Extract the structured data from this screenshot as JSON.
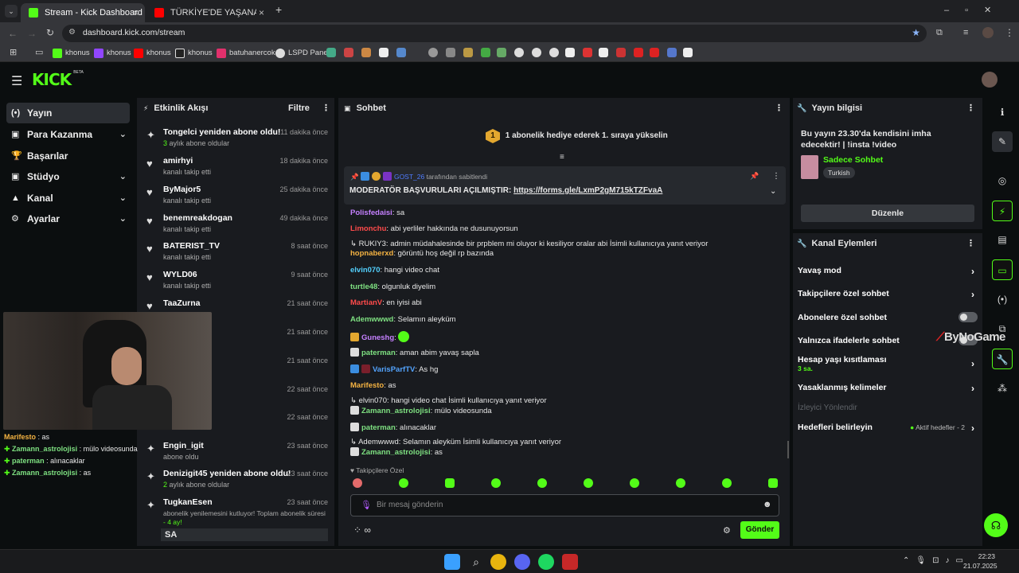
{
  "browser": {
    "tabs": [
      {
        "title": "Stream - Kick Dashboard",
        "active": true
      },
      {
        "title": "TÜRKİYE'DE YAŞANAN MOTOR",
        "active": false
      }
    ],
    "new_tab": "+",
    "url": "dashboard.kick.com/stream",
    "bookmarks": [
      {
        "label": "khonus",
        "color": "#53fc18"
      },
      {
        "label": "khonus",
        "color": "#9146ff"
      },
      {
        "label": "khonus",
        "color": "#ff0000"
      },
      {
        "label": "khonus",
        "color": "#ffffff"
      },
      {
        "label": "batuhanercok",
        "color": "#e1306c"
      },
      {
        "label": "LSPD Panel",
        "color": "#dddddd"
      }
    ]
  },
  "app": {
    "logo": "KICK",
    "logo_sup": "BETA"
  },
  "sidebar": {
    "items": [
      {
        "label": "Yayın",
        "icon": "(•)",
        "chevron": false,
        "active": true
      },
      {
        "label": "Para Kazanma",
        "icon": "▣",
        "chevron": true
      },
      {
        "label": "Başarılar",
        "icon": "🏆",
        "chevron": false
      },
      {
        "label": "Stüdyo",
        "icon": "▣",
        "chevron": true
      },
      {
        "label": "Kanal",
        "icon": "▲",
        "chevron": true
      },
      {
        "label": "Ayarlar",
        "icon": "⚙",
        "chevron": true
      }
    ]
  },
  "activity": {
    "title": "Etkinlik Akışı",
    "filter": "Filtre",
    "items": [
      {
        "name": "Tongelci yeniden abone oldu!",
        "sub_highlight": "3",
        "sub": " aylık abone oldular",
        "time": "11 dakika önce",
        "icon": "✦"
      },
      {
        "name": "amirhyi",
        "sub": "kanalı takip etti",
        "time": "18 dakika önce",
        "icon": "♥"
      },
      {
        "name": "ByMajor5",
        "sub": "kanalı takip etti",
        "time": "25 dakika önce",
        "icon": "♥"
      },
      {
        "name": "benemreakdogan",
        "sub": "kanalı takip etti",
        "time": "49 dakika önce",
        "icon": "♥"
      },
      {
        "name": "BATERIST_TV",
        "sub": "kanalı takip etti",
        "time": "8 saat önce",
        "icon": "♥"
      },
      {
        "name": "WYLD06",
        "sub": "kanalı takip etti",
        "time": "9 saat önce",
        "icon": "♥"
      },
      {
        "name": "TaaZurna",
        "sub": "kanalı takip etti",
        "time": "21 saat önce",
        "icon": "♥"
      },
      {
        "name": "",
        "sub": "",
        "time": "21 saat önce",
        "icon": ""
      },
      {
        "name": "",
        "sub": "",
        "time": "21 saat önce",
        "icon": ""
      },
      {
        "name": "",
        "sub": "",
        "time": "22 saat önce",
        "icon": ""
      },
      {
        "name": "",
        "sub": "",
        "time": "22 saat önce",
        "icon": ""
      },
      {
        "name": "Engin_igit",
        "sub": "abone oldu",
        "time": "23 saat önce",
        "icon": "✦"
      },
      {
        "name": "Denizigit45 yeniden abone oldu!",
        "sub_highlight": "2",
        "sub": " aylık abone oldular",
        "time": "23 saat önce",
        "icon": "✦"
      },
      {
        "name": "TugkanEsen",
        "sub": "abonelik yenilemesini kutluyor! Toplam abonelik süresi",
        "sub2": "- 4 ay!",
        "time": "23 saat önce",
        "icon": "✦"
      }
    ],
    "footer": "SA"
  },
  "overlay_chat": [
    {
      "user": "Marifesto",
      "msg": " : as",
      "color": "#f5b342",
      "badge": false
    },
    {
      "user": "Zamann_astrolojisi",
      "msg": " : mülo videosunda",
      "color": "#7ee081",
      "badge": true
    },
    {
      "user": "paterman",
      "msg": " : alınacaklar",
      "color": "#7ee081",
      "badge": true
    },
    {
      "user": "Zamann_astrolojisi",
      "msg": " : as",
      "color": "#7ee081",
      "badge": true
    }
  ],
  "chat": {
    "title": "Sohbet",
    "gift_banner": "1 abonelik hediye ederek 1. sıraya yükselin",
    "gift_rank": "1",
    "pinned": {
      "by": "GOST_26",
      "by_suffix": " tarafından sabitlendi",
      "text": "MODERATÖR BAŞVURULARI AÇILMIŞTIR: ",
      "link": "https://forms.gle/LxmP2gM715kTZFvaA"
    },
    "messages": [
      {
        "user": "Polisfedaisi",
        "msg": ": sa",
        "color": "#c580ff"
      },
      {
        "user": "Limonchu",
        "msg": ": abi yerliler hakkında ne dusunuyorsun",
        "color": "#ff4b4b"
      },
      {
        "reply": "↳ RUKIY3: admin müdahalesinde bir prpblem mi oluyor ki kesiliyor oralar abi İsimli kullanıcıya yanıt veriyor"
      },
      {
        "user": "hopnaberxd",
        "msg": ": görüntü hoş değil rp bazında",
        "color": "#f5b342"
      },
      {
        "user": "elvin070",
        "msg": ": hangi video chat",
        "color": "#53d1ff"
      },
      {
        "user": "turtle48",
        "msg": ": olgunluk diyelim",
        "color": "#7ee081"
      },
      {
        "user": "MartianV",
        "msg": ": en iyisi abi",
        "color": "#ff4b4b"
      },
      {
        "user": "Ademwwwd",
        "msg": ": Selamın aleyküm",
        "color": "#7ee081"
      },
      {
        "user": "Guneshg",
        "msg": ": ",
        "color": "#c580ff",
        "emote": true
      },
      {
        "user": "paterman",
        "msg": ": aman abim yavaş sapla",
        "color": "#7ee081"
      },
      {
        "user": "VarisParfTV",
        "msg": ": As hg",
        "color": "#53a4ff"
      },
      {
        "user": "Marifesto",
        "msg": ": as",
        "color": "#f5b342"
      },
      {
        "reply": "↳ elvin070: hangi video chat İsimli kullanıcıya yanıt veriyor"
      },
      {
        "user": "Zamann_astrolojisi",
        "msg": ": mülo videosunda",
        "color": "#7ee081"
      },
      {
        "user": "paterman",
        "msg": ": alınacaklar",
        "color": "#7ee081"
      },
      {
        "reply": "↳ Ademwwwd: Selamın aleyküm İsimli kullanıcıya yanıt veriyor"
      },
      {
        "user": "Zamann_astrolojisi",
        "msg": ": as",
        "color": "#7ee081"
      }
    ],
    "followers_only": "Takipçilere Özel",
    "input_placeholder": "Bir mesaj gönderin",
    "send": "Gönder",
    "points": "∞"
  },
  "stream_info": {
    "title": "Yayın bilgisi",
    "stream_title": "Bu yayın 23.30'da kendisini imha edecektir! | !insta !video",
    "category": "Sadece Sohbet",
    "language": "Turkish",
    "edit": "Düzenle"
  },
  "channel_actions": {
    "title": "Kanal Eylemleri",
    "items": [
      {
        "label": "Yavaş mod",
        "chevron": true
      },
      {
        "label": "Takipçilere özel sohbet",
        "chevron": true
      },
      {
        "label": "Abonelere özel sohbet",
        "toggle": true
      },
      {
        "label": "Yalnızca ifadelerle sohbet",
        "toggle": true
      },
      {
        "label": "Hesap yaşı kısıtlaması",
        "sub": "3 sa.",
        "chevron": true
      },
      {
        "label": "Yasaklanmış kelimeler",
        "chevron": true
      },
      {
        "label": "İzleyici Yönlendir",
        "disabled": true
      },
      {
        "label": "Hedefleri belirleyin",
        "status": "Aktif hedefler - 2",
        "chevron": true
      }
    ]
  },
  "watermark": "ByNoGame",
  "taskbar": {
    "time": "22:23",
    "date": "21.07.2025"
  }
}
